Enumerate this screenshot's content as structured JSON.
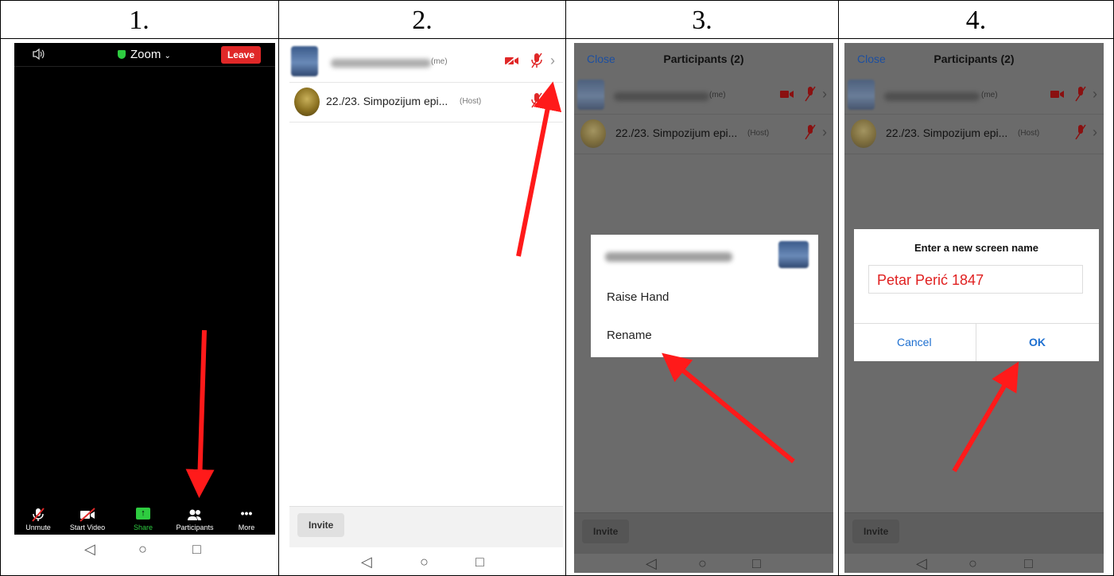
{
  "panels": {
    "labels": [
      "1.",
      "2.",
      "3.",
      "4."
    ]
  },
  "panel1": {
    "title": "Zoom",
    "leave_label": "Leave",
    "toolbar": {
      "unmute": "Unmute",
      "start_video": "Start Video",
      "share": "Share",
      "participants": "Participants",
      "more": "More"
    }
  },
  "participants": {
    "header_close": "Close",
    "header_title": "Participants (2)",
    "me_tag": "(me)",
    "host_name": "22./23. Simpozijum epi...",
    "host_tag": "(Host)",
    "invite_label": "Invite"
  },
  "menu": {
    "raise_hand": "Raise Hand",
    "rename": "Rename"
  },
  "rename_dialog": {
    "title": "Enter a new screen name",
    "value": "Petar Perić 1847",
    "cancel": "Cancel",
    "ok": "OK"
  },
  "colors": {
    "accent_red": "#e02828",
    "zoom_green": "#2ecc40",
    "link_blue": "#1d6fd0"
  }
}
